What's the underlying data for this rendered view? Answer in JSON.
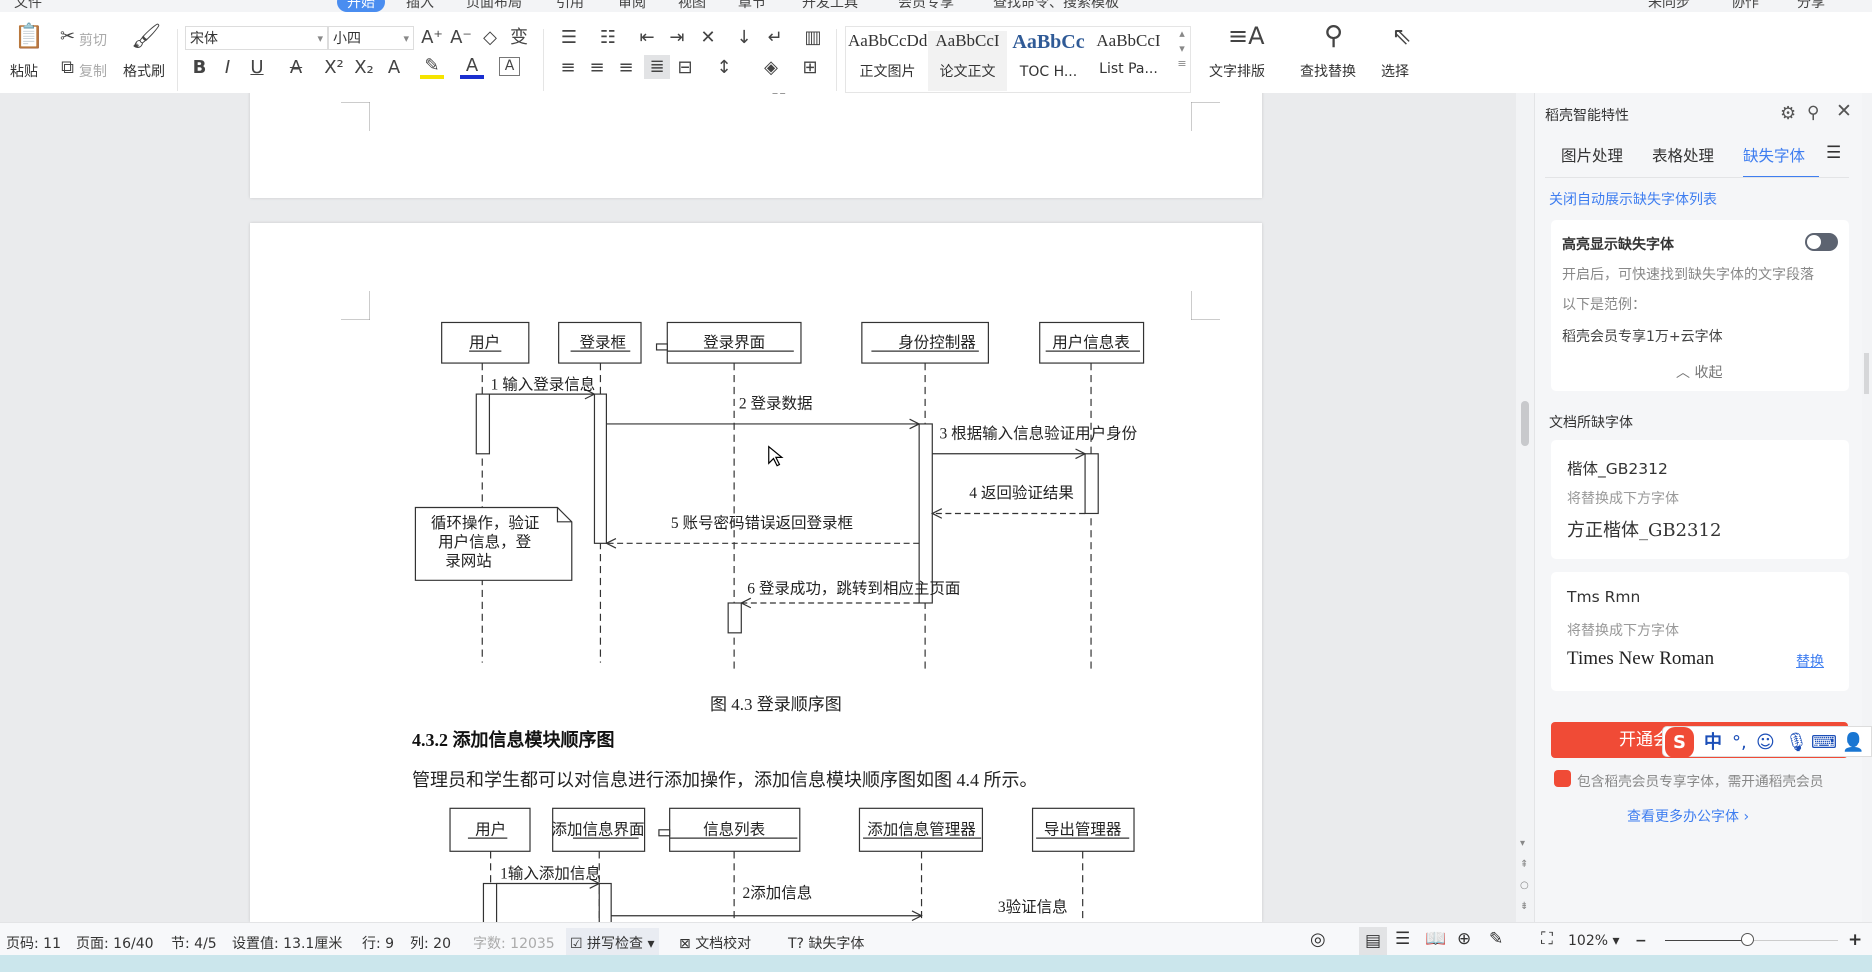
{
  "menubar": {
    "items": [
      "文件",
      "开始",
      "插入",
      "页面布局",
      "引用",
      "审阅",
      "视图",
      "章节",
      "开发工具",
      "会员专享"
    ],
    "search_placeholder": "查找命令、搜索模板",
    "right": [
      "未同步",
      "协作",
      "分享"
    ]
  },
  "ribbon": {
    "paste": "粘贴",
    "cut": "剪切",
    "copy": "复制",
    "format_painter": "格式刷",
    "font_name": "宋体",
    "font_size": "小四",
    "styles": [
      {
        "preview": "AaBbCcDd",
        "label": "正文图片"
      },
      {
        "preview": "AaBbCcI",
        "label": "论文正文"
      },
      {
        "preview": "AaBbCc",
        "label": "TOC H..."
      },
      {
        "preview": "AaBbCcI",
        "label": "List Pa..."
      }
    ],
    "text_layout": "文字排版",
    "find_replace": "查找替换",
    "select": "选择"
  },
  "document": {
    "page_number_top": "11",
    "diagram1": {
      "objects": [
        "用户",
        "登录框",
        "登录界面",
        "身份控制器",
        "用户信息表"
      ],
      "messages": [
        "1 输入登录信息",
        "2 登录数据",
        "3 根据输入信息验证用户身份",
        "4 返回验证结果",
        "5 账号密码错误返回登录框",
        "6 登录成功，跳转到相应主页面"
      ],
      "note": [
        "循环操作，验证",
        "用户信息，登",
        "录网站"
      ],
      "caption": "图 4.3  登录顺序图"
    },
    "heading": "4.3.2 添加信息模块顺序图",
    "paragraph": "管理员和学生都可以对信息进行添加操作，添加信息模块顺序图如图 4.4 所示。",
    "diagram2": {
      "objects": [
        "用户",
        "添加信息界面",
        "信息列表",
        "添加信息管理器",
        "导出管理器"
      ],
      "messages": [
        "1输入添加信息",
        "2添加信息",
        "3验证信息"
      ]
    }
  },
  "panel": {
    "title": "稻壳智能特性",
    "tabs": [
      "图片处理",
      "表格处理",
      "缺失字体"
    ],
    "active_tab": "缺失字体",
    "close_auto_link": "关闭自动展示缺失字体列表",
    "highlight": {
      "title": "高亮显示缺失字体",
      "toggle_on": false,
      "desc": "开启后，可快速找到缺失字体的文字段落",
      "example_label": "以下是范例：",
      "example": "稻壳会员专享1万+云字体",
      "collapse": "收起"
    },
    "missing_title": "文档所缺字体",
    "fonts": [
      {
        "name": "楷体_GB2312",
        "hint": "将替换成下方字体",
        "replacement": "方正楷体_GB2312"
      },
      {
        "name": "Tms Rmn",
        "hint": "将替换成下方字体",
        "replacement": "Times New Roman",
        "action": "替换"
      }
    ],
    "cta": "开通会员",
    "cta_note": "包含稻壳会员专享字体，需开通稻壳会员",
    "more_link": "查看更多办公字体 ›",
    "accent": "#3f7ef0",
    "cta_color": "#f04b36"
  },
  "ime": {
    "lang": "中",
    "punct": "°,"
  },
  "status": {
    "page_code": "页码: 11",
    "pages": "页面: 16/40",
    "section": "节: 4/5",
    "setting": "设置值: 13.1厘米",
    "row": "行: 9",
    "col": "列: 20",
    "word_count": "字数: 12035",
    "spellcheck": "拼写检查",
    "proofread": "文档校对",
    "missing_font": "缺失字体",
    "zoom": "102%",
    "zoom_percent": 102
  }
}
